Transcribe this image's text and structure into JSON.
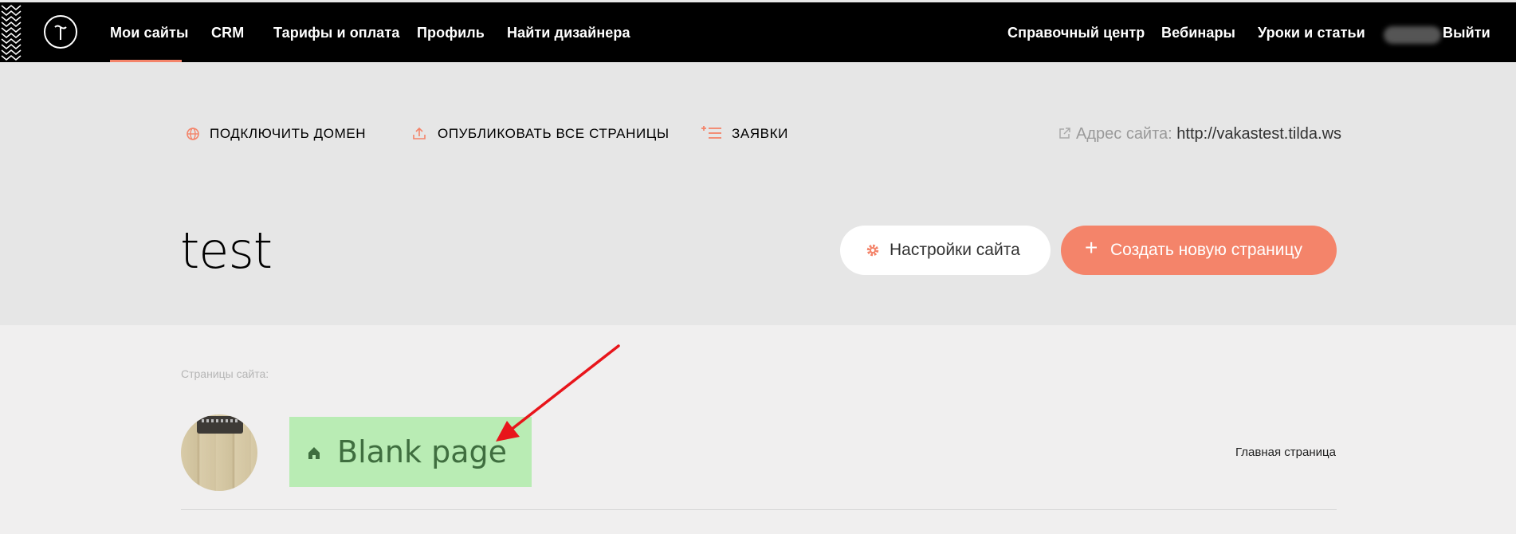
{
  "nav": {
    "left_items": [
      {
        "label": "Мои сайты"
      },
      {
        "label": "CRM"
      },
      {
        "label": "Тарифы и оплата"
      },
      {
        "label": "Профиль"
      },
      {
        "label": "Найти дизайнера"
      }
    ],
    "right_items": [
      {
        "label": "Справочный центр"
      },
      {
        "label": "Вебинары"
      },
      {
        "label": "Уроки и статьи"
      }
    ],
    "logout": "Выйти",
    "active_index": 0
  },
  "actions": {
    "connect_domain": "ПОДКЛЮЧИТЬ ДОМЕН",
    "publish_all": "ОПУБЛИКОВАТЬ ВСЕ СТРАНИЦЫ",
    "requests": "ЗАЯВКИ"
  },
  "site": {
    "address_label": "Адрес сайта:",
    "address_url": "http://vakastest.tilda.ws",
    "title": "test",
    "settings_button": "Настройки сайта",
    "create_button": "Создать новую страницу",
    "create_plus": "+"
  },
  "pages": {
    "section_label": "Страницы сайта:",
    "items": [
      {
        "title": "Blank page",
        "badge": "Главная страница"
      }
    ]
  },
  "colors": {
    "accent": "#f4846a",
    "highlight": "#b9ecb4",
    "annotation_arrow": "#e8151b",
    "topbar": "#000000"
  }
}
